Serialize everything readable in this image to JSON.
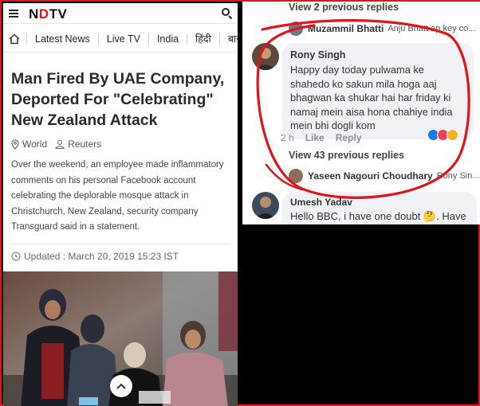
{
  "left": {
    "header": {
      "logo_prefix": "N",
      "logo_red": "D",
      "logo_suffix": "TV"
    },
    "nav": {
      "items": [
        "Latest News",
        "Live TV",
        "India",
        "हिंदी",
        "बाज़"
      ]
    },
    "article": {
      "headline": "Man Fired By UAE Company, Deported For \"Celebrating\" New Zealand Attack",
      "category": "World",
      "source": "Reuters",
      "body": "Over the weekend, an employee made inflammatory comments on his personal Facebook account celebrating the deplorable mosque attack in Christchurch, New Zealand, security company Transguard said in a statement.",
      "updated": "Updated : March 20, 2019 15:23 IST"
    }
  },
  "right": {
    "view_prev_top": "View 2 previous replies",
    "reply_preview_1": {
      "name": "Muzammil Bhatti",
      "snippet": "Anju Bhatt ap key co..."
    },
    "comment": {
      "author": "Rony Singh",
      "text": "Happy day today pulwama ke shahedo ko sakun mila hoga aaj bhagwan ka shukar hai har friday ki namaj mein aisa hona chahiye india mein bhi dogli kom",
      "time": "2 h",
      "like": "Like",
      "reply": "Reply"
    },
    "view_prev_43": "View 43 previous replies",
    "reply_preview_2": {
      "name": "Yaseen Nagouri Choudhary",
      "snippet": "Rony Sin..."
    },
    "comment2": {
      "author": "Umesh Yadav",
      "text": "Hello BBC, i have one doubt 🤔. Have"
    }
  },
  "colors": {
    "accent_red": "#e0141b",
    "fb_bubble": "#f0f2f5",
    "scribble": "#e0141b"
  }
}
